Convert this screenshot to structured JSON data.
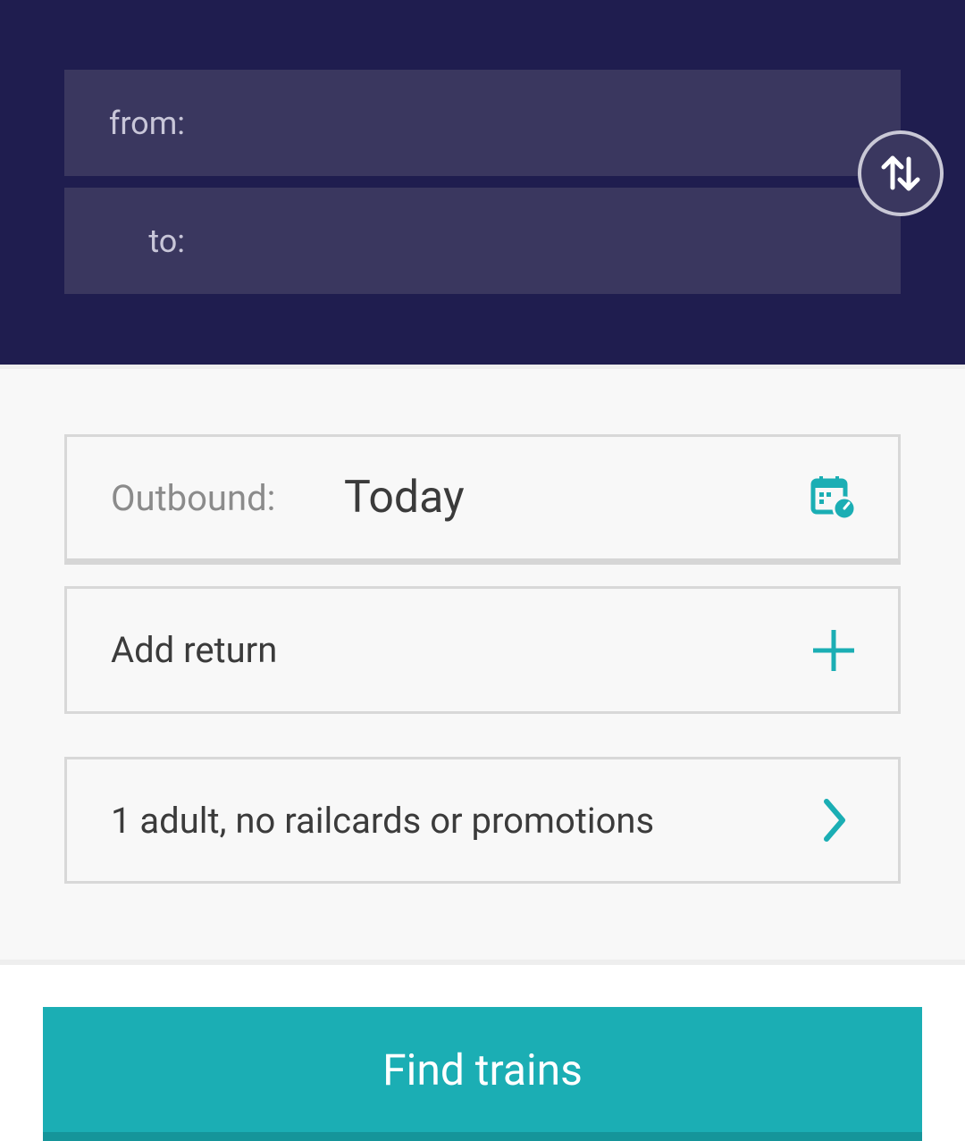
{
  "search": {
    "from_label": "from:",
    "from_value": "",
    "to_label": "to:",
    "to_value": "",
    "swap_icon": "swap-vertical-icon"
  },
  "outbound": {
    "label": "Outbound:",
    "value": "Today",
    "icon": "calendar-clock-icon"
  },
  "return": {
    "label": "Add return",
    "icon": "plus-icon"
  },
  "passengers": {
    "label": "1 adult, no railcards or promotions",
    "icon": "chevron-right-icon"
  },
  "actions": {
    "find_label": "Find trains"
  },
  "colors": {
    "header_bg": "#1f1d4f",
    "field_bg": "#3a375f",
    "accent": "#1baeb4"
  }
}
